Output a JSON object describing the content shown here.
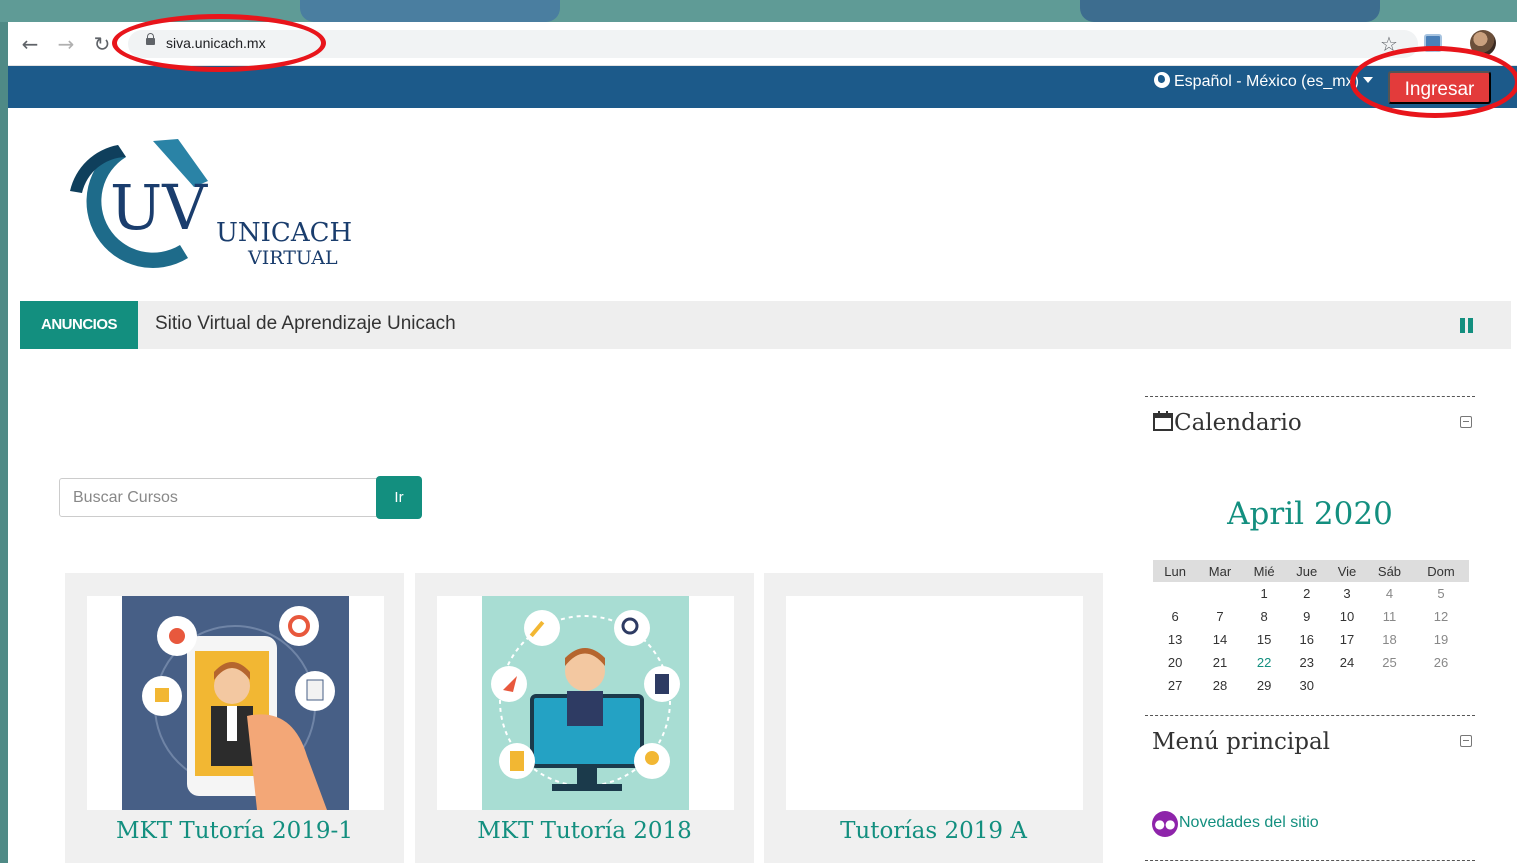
{
  "browser": {
    "url": "siva.unicach.mx"
  },
  "topbar": {
    "language": "Español - México (es_mx)",
    "login_label": "Ingresar"
  },
  "logo": {
    "letters": "UV",
    "line1": "UNICACH",
    "line2": "VIRTUAL"
  },
  "announcement": {
    "tag": "ANUNCIOS",
    "text": "Sitio Virtual de Aprendizaje Unicach"
  },
  "search": {
    "placeholder": "Buscar Cursos",
    "button_label": "Ir"
  },
  "courses": [
    {
      "title": "MKT Tutoría 2019-1"
    },
    {
      "title": "MKT Tutoría 2018"
    },
    {
      "title": "Tutorías 2019 A"
    }
  ],
  "calendar": {
    "block_title": "Calendario",
    "month": "April 2020",
    "weekdays": [
      "Lun",
      "Mar",
      "Mié",
      "Jue",
      "Vie",
      "Sáb",
      "Dom"
    ],
    "weeks": [
      [
        "",
        "",
        "1",
        "2",
        "3",
        "4",
        "5"
      ],
      [
        "6",
        "7",
        "8",
        "9",
        "10",
        "11",
        "12"
      ],
      [
        "13",
        "14",
        "15",
        "16",
        "17",
        "18",
        "19"
      ],
      [
        "20",
        "21",
        "22",
        "23",
        "24",
        "25",
        "26"
      ],
      [
        "27",
        "28",
        "29",
        "30",
        "",
        "",
        ""
      ]
    ],
    "today": "22"
  },
  "main_menu": {
    "block_title": "Menú principal",
    "items": [
      {
        "label": "Novedades del sitio"
      }
    ]
  },
  "colors": {
    "topbar": "#1c5a8a",
    "accent": "#138f7f",
    "login": "#e33b3b",
    "highlight": "#e8151b"
  }
}
